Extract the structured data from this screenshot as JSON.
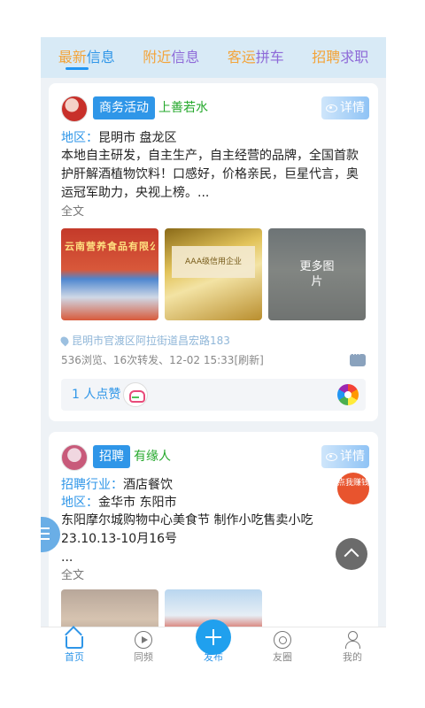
{
  "tabs": [
    {
      "a": "最新",
      "b": "信息",
      "color_a": "#f3a43a",
      "color_b": "#2f96e8",
      "active": true
    },
    {
      "a": "附近",
      "b": "信息",
      "color_a": "#f3a43a",
      "color_b": "#8e6ad8"
    },
    {
      "a": "客运",
      "b": "拼车",
      "color_a": "#f3a43a",
      "color_b": "#8e6ad8"
    },
    {
      "a": "招聘",
      "b": "求职",
      "color_a": "#f3a43a",
      "color_b": "#8e6ad8"
    }
  ],
  "post1": {
    "category": "商务活动",
    "user": "上善若水",
    "detail_label": "详情",
    "region_label": "地区：",
    "region": "昆明市 盘龙区",
    "body": "本地自主研发，自主生产，自主经营的品牌，全国首款护肝解酒植物饮料！口感好，价格亲民，巨星代言，奥运冠军助力，央视上榜。...",
    "fulltext": "全文",
    "thumb1_sign": "云南营养食品有限公司",
    "thumb2_plaque": "AAA级信用企业",
    "more_images": "更多图片",
    "location": "昆明市官渡区阿拉街道昌宏路183",
    "stats": "536浏览、16次转发、12-02 15:33[刷新]",
    "likes": "1 人点赞"
  },
  "post2": {
    "category": "招聘",
    "user": "有缘人",
    "detail_label": "详情",
    "industry_label": "招聘行业：",
    "industry": "酒店餐饮",
    "region_label": "地区：",
    "region": "金华市 东阳市",
    "body": "东阳摩尔城购物中心美食节 制作小吃售卖小吃 23.10.13-10月16号",
    "ellipsis": "...",
    "fulltext": "全文",
    "earn_badge": "点我赚钱"
  },
  "nav": {
    "home": "首页",
    "video": "同频",
    "publish": "发布",
    "circle": "友圈",
    "me": "我的"
  }
}
